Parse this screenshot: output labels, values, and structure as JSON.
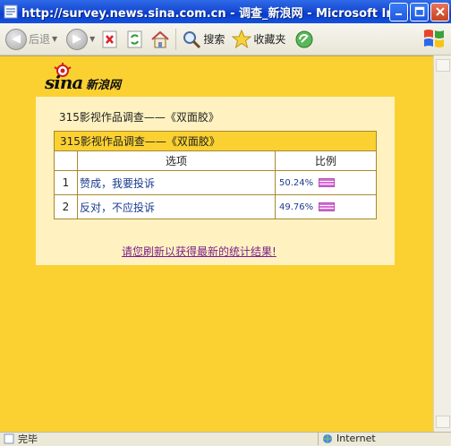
{
  "window": {
    "title": "http://survey.news.sina.com.cn - 调查_新浪网 - Microsoft Int…"
  },
  "toolbar": {
    "back_label": "后退",
    "search_label": "搜索",
    "favorites_label": "收藏夹"
  },
  "logo": {
    "brand_text": "sina",
    "brand_cn": "新浪网"
  },
  "survey": {
    "heading": "315影视作品调查——《双面胶》",
    "table_title": "315影视作品调查——《双面胶》",
    "col_option": "选项",
    "col_ratio": "比例",
    "rows": [
      {
        "num": "1",
        "option": "赞成，我要投诉",
        "percent": "50.24%",
        "value": 50.24
      },
      {
        "num": "2",
        "option": "反对，不应投诉",
        "percent": "49.76%",
        "value": 49.76
      }
    ],
    "refresh_text": "请您刷新以获得最新的统计结果!"
  },
  "status": {
    "left": "完毕",
    "right": "Internet"
  },
  "colors": {
    "page_bg": "#fbd131",
    "panel_bg": "#fff2c0",
    "link": "#1a3a8f",
    "bar": "#d76cd4"
  }
}
